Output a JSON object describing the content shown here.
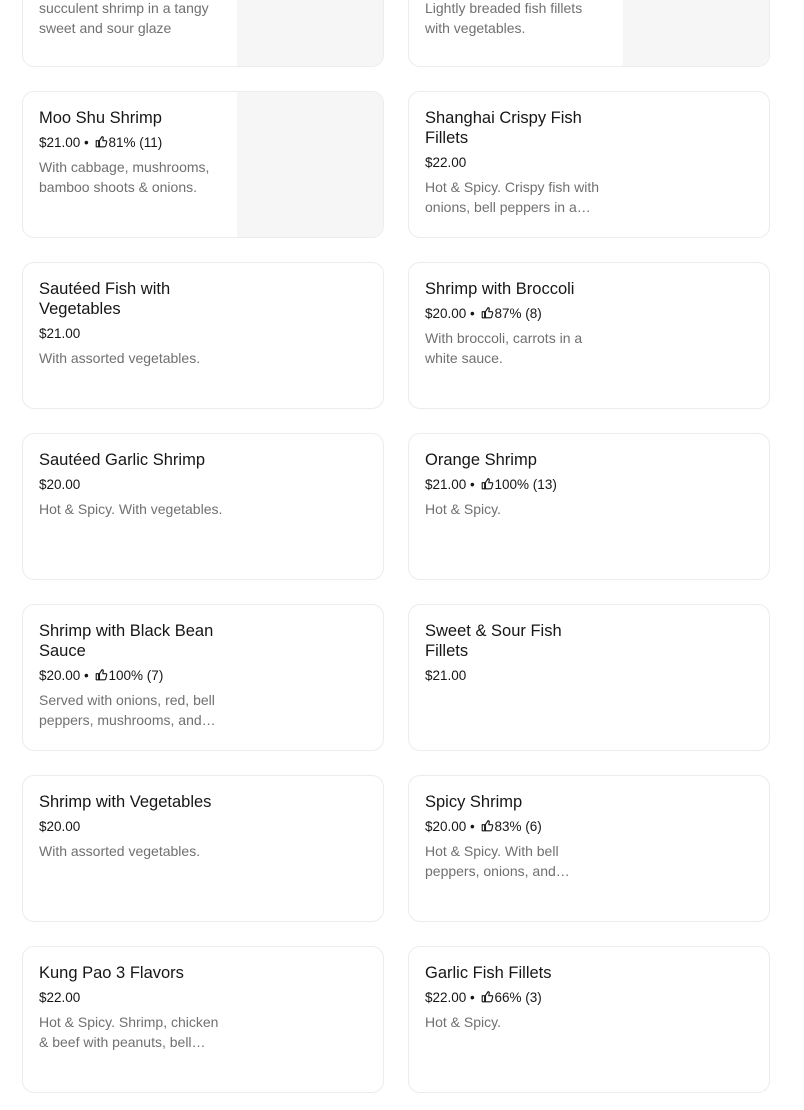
{
  "items": [
    {
      "id": "r0l",
      "name": "",
      "price": "",
      "rating": "",
      "desc": "succulent shrimp in a tangy sweet and sour glaze",
      "img": true
    },
    {
      "id": "r0r",
      "name": "",
      "price": "",
      "rating": "",
      "desc": "Lightly breaded fish fillets with vegetables.",
      "img": true
    },
    {
      "id": "r1l",
      "name": "Moo Shu Shrimp",
      "price": "$21.00",
      "rating": "81% (11)",
      "desc": "With cabbage, mushrooms, bamboo shoots & onions.",
      "img": true
    },
    {
      "id": "r1r",
      "name": "Shanghai Crispy Fish Fillets",
      "price": "$22.00",
      "rating": "",
      "desc": "Hot & Spicy. Crispy fish with onions, bell peppers in a…",
      "img": false
    },
    {
      "id": "r2l",
      "name": "Sautéed Fish with Vegetables",
      "price": "$21.00",
      "rating": "",
      "desc": "With assorted vegetables.",
      "img": false
    },
    {
      "id": "r2r",
      "name": "Shrimp with Broccoli",
      "price": "$20.00",
      "rating": "87% (8)",
      "desc": "With broccoli, carrots in a white sauce.",
      "img": false
    },
    {
      "id": "r3l",
      "name": "Sautéed Garlic Shrimp",
      "price": "$20.00",
      "rating": "",
      "desc": "Hot & Spicy. With vegetables.",
      "img": false
    },
    {
      "id": "r3r",
      "name": "Orange Shrimp",
      "price": "$21.00",
      "rating": "100% (13)",
      "desc": "Hot & Spicy.",
      "img": false
    },
    {
      "id": "r4l",
      "name": "Shrimp with Black Bean Sauce",
      "price": "$20.00",
      "rating": "100% (7)",
      "desc": "Served with onions, red, bell peppers, mushrooms, and…",
      "img": false
    },
    {
      "id": "r4r",
      "name": "Sweet & Sour Fish Fillets",
      "price": "$21.00",
      "rating": "",
      "desc": "",
      "img": false
    },
    {
      "id": "r5l",
      "name": "Shrimp with Vegetables",
      "price": "$20.00",
      "rating": "",
      "desc": "With assorted vegetables.",
      "img": false
    },
    {
      "id": "r5r",
      "name": "Spicy Shrimp",
      "price": "$20.00",
      "rating": "83% (6)",
      "desc": "Hot & Spicy. With bell peppers, onions, and…",
      "img": false
    },
    {
      "id": "r6l",
      "name": "Kung Pao 3 Flavors",
      "price": "$22.00",
      "rating": "",
      "desc": "Hot & Spicy. Shrimp, chicken & beef with peanuts, bell…",
      "img": false
    },
    {
      "id": "r6r",
      "name": "Garlic Fish Fillets",
      "price": "$22.00",
      "rating": "66% (3)",
      "desc": "Hot & Spicy.",
      "img": false
    }
  ],
  "separator": " • ",
  "icons": {
    "rating": "thumbs-up-icon"
  },
  "colors": {
    "text": "#161616",
    "muted": "#707070",
    "border": "#ececec",
    "placeholder": "#f6f6f6"
  }
}
